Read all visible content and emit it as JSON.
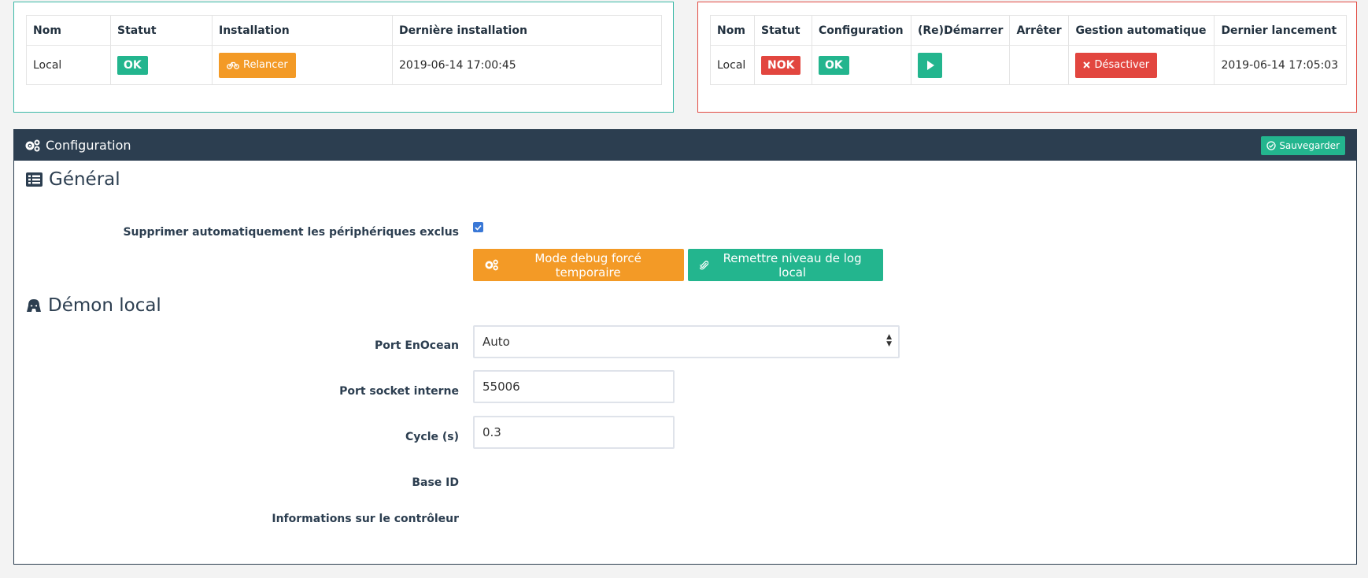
{
  "dependencies": {
    "headers": [
      "Nom",
      "Statut",
      "Installation",
      "Dernière installation"
    ],
    "row": {
      "name": "Local",
      "status": "OK",
      "install_button": "Relancer",
      "last_install": "2019-06-14 17:00:45"
    }
  },
  "daemon": {
    "headers": [
      "Nom",
      "Statut",
      "Configuration",
      "(Re)Démarrer",
      "Arrêter",
      "Gestion automatique",
      "Dernier lancement"
    ],
    "row": {
      "name": "Local",
      "status": "NOK",
      "configuration": "OK",
      "auto_button": "Désactiver",
      "last_launch": "2019-06-14 17:05:03"
    }
  },
  "config": {
    "title": "Configuration",
    "save_label": "Sauvegarder",
    "general_title": "Général",
    "auto_remove_label": "Supprimer automatiquement les périphériques exclus",
    "auto_remove_checked": true,
    "debug_button": "Mode debug forcé temporaire",
    "log_button": "Remettre niveau de log local",
    "daemon_title": "Démon local",
    "port_label": "Port EnOcean",
    "port_value": "Auto",
    "socket_label": "Port socket interne",
    "socket_value": "55006",
    "cycle_label": "Cycle (s)",
    "cycle_value": "0.3",
    "base_id_label": "Base ID",
    "controller_label": "Informations sur le contrôleur"
  },
  "colors": {
    "ok": "#23b58e",
    "nok": "#e2463f",
    "warning": "#f39a26",
    "header": "#2c3e50"
  }
}
